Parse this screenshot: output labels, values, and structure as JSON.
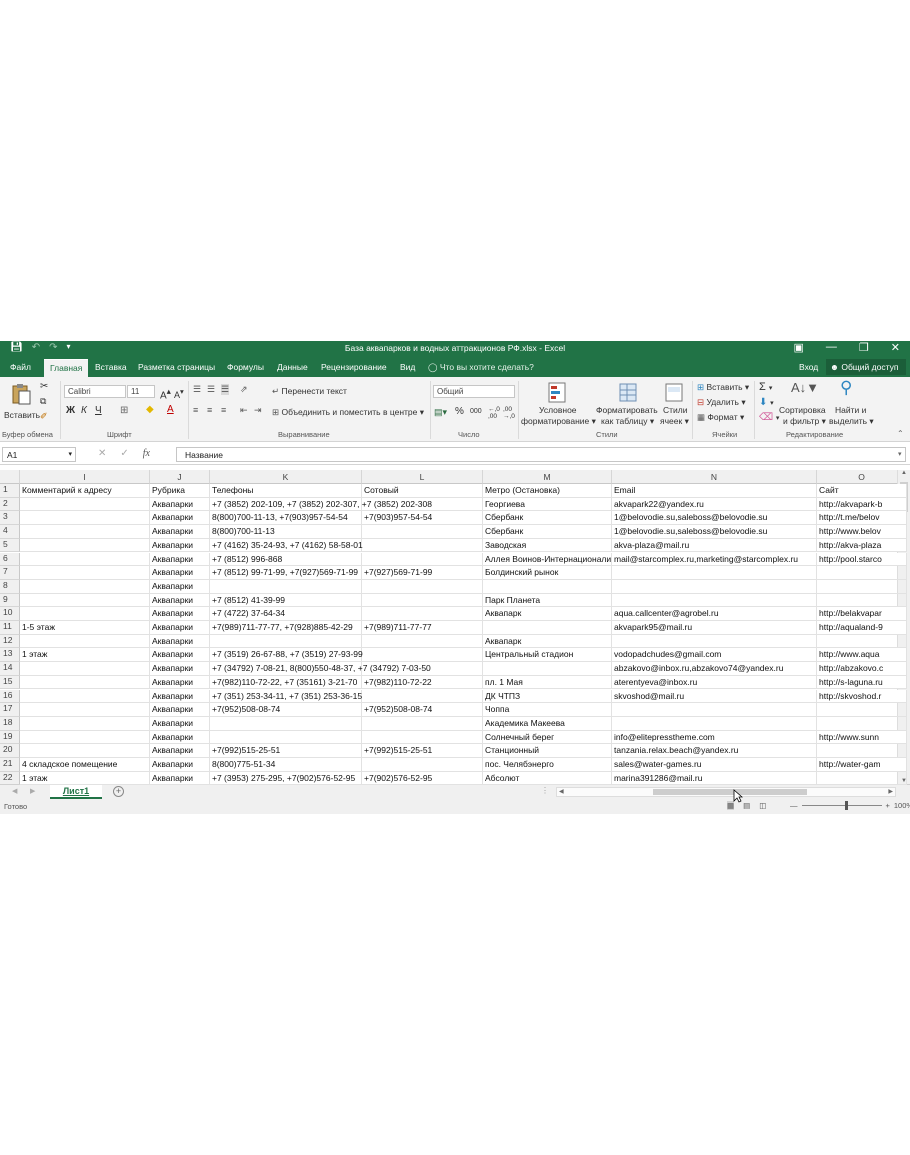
{
  "window": {
    "title": "База аквапарков и водных аттракционов РФ.xlsx - Excel"
  },
  "ribbon_tabs": [
    "Файл",
    "Главная",
    "Вставка",
    "Разметка страницы",
    "Формулы",
    "Данные",
    "Рецензирование",
    "Вид"
  ],
  "tell_me": "Что вы хотите сделать?",
  "signin": "Вход",
  "share": "Общий доступ",
  "ribbon": {
    "paste": "Вставить",
    "font_name": "Calibri",
    "font_size": "11",
    "wrap_text": "Перенести текст",
    "merge_center": "Объединить и поместить в центре",
    "number_format": "Общий",
    "cond_format_1": "Условное",
    "cond_format_2": "форматирование",
    "format_table_1": "Форматировать",
    "format_table_2": "как таблицу",
    "styles_1": "Стили",
    "styles_2": "ячеек",
    "insert": "Вставить",
    "delete": "Удалить",
    "format": "Формат",
    "sort_1": "Сортировка",
    "sort_2": "и фильтр",
    "find_1": "Найти и",
    "find_2": "выделить",
    "bold": "Ж",
    "italic": "К",
    "underline": "Ч",
    "groups": {
      "clipboard": "Буфер обмена",
      "font": "Шрифт",
      "alignment": "Выравнивание",
      "number": "Число",
      "styles": "Стили",
      "cells": "Ячейки",
      "editing": "Редактирование"
    }
  },
  "formula_bar": {
    "name_box": "A1",
    "fx": "fx",
    "content": "Название"
  },
  "sheet": {
    "columns": [
      "I",
      "J",
      "K",
      "L",
      "M",
      "N",
      "O"
    ],
    "row_numbers": [
      "1",
      "2",
      "3",
      "4",
      "5",
      "6",
      "7",
      "8",
      "9",
      "10",
      "11",
      "12",
      "13",
      "14",
      "15",
      "16",
      "17",
      "18",
      "19",
      "20",
      "21",
      "22"
    ],
    "rows": [
      [
        "Комментарий к адресу",
        "Рубрика",
        "Телефоны",
        "Сотовый",
        "Метро (Остановка)",
        "Email",
        "Сайт"
      ],
      [
        "",
        "Аквапарки",
        "+7 (3852) 202-109, +7 (3852) 202-307, +7 (3852) 202-308",
        "",
        "Георгиева",
        "akvapark22@yandex.ru",
        "http://akvapark-b"
      ],
      [
        "",
        "Аквапарки",
        "8(800)700-11-13, +7(903)957-54-54",
        "+7(903)957-54-54",
        "Сбербанк",
        "1@belovodie.su,saleboss@belovodie.su",
        "http://t.me/belov"
      ],
      [
        "",
        "Аквапарки",
        "8(800)700-11-13",
        "",
        "Сбербанк",
        "1@belovodie.su,saleboss@belovodie.su",
        "http://www.belov"
      ],
      [
        "",
        "Аквапарки",
        "+7 (4162) 35-24-93, +7 (4162) 58-58-01",
        "",
        "Заводская",
        "akva-plaza@mail.ru",
        "http://akva-plaza"
      ],
      [
        "",
        "Аквапарки",
        "+7 (8512) 996-868",
        "",
        "Аллея Воинов-Интернационалистов",
        "mail@starcomplex.ru,marketing@starcomplex.ru",
        "http://pool.starco"
      ],
      [
        "",
        "Аквапарки",
        "+7 (8512) 99-71-99, +7(927)569-71-99",
        "+7(927)569-71-99",
        "Болдинский рынок",
        "",
        ""
      ],
      [
        "",
        "Аквапарки",
        "",
        "",
        "",
        "",
        ""
      ],
      [
        "",
        "Аквапарки",
        "+7 (8512) 41-39-99",
        "",
        "Парк Планета",
        "",
        ""
      ],
      [
        "",
        "Аквапарки",
        "+7 (4722) 37-64-34",
        "",
        "Аквапарк",
        "aqua.callcenter@agrobel.ru",
        "http://belakvapar"
      ],
      [
        "1-5 этаж",
        "Аквапарки",
        "+7(989)711-77-77, +7(928)885-42-29",
        "+7(989)711-77-77",
        "",
        "akvapark95@mail.ru",
        "http://aqualand-9"
      ],
      [
        "",
        "Аквапарки",
        "",
        "",
        "Аквапарк",
        "",
        ""
      ],
      [
        "1 этаж",
        "Аквапарки",
        "+7 (3519) 26-67-88, +7 (3519) 27-93-99",
        "",
        "Центральный стадион",
        "vodopadchudes@gmail.com",
        "http://www.aqua"
      ],
      [
        "",
        "Аквапарки",
        "+7 (34792) 7-08-21, 8(800)550-48-37, +7 (34792) 7-03-50",
        "",
        "",
        "abzakovo@inbox.ru,abzakovo74@yandex.ru",
        "http://abzakovo.c"
      ],
      [
        "",
        "Аквапарки",
        "+7(982)110-72-22, +7 (35161) 3-21-70",
        "+7(982)110-72-22",
        "пл. 1 Мая",
        "aterentyeva@inbox.ru",
        "http://s-laguna.ru"
      ],
      [
        "",
        "Аквапарки",
        "+7 (351) 253-34-11, +7 (351) 253-36-15",
        "",
        "ДК ЧТПЗ",
        "skvoshod@mail.ru",
        "http://skvoshod.r"
      ],
      [
        "",
        "Аквапарки",
        "+7(952)508-08-74",
        "+7(952)508-08-74",
        "Чоппа",
        "",
        ""
      ],
      [
        "",
        "Аквапарки",
        "",
        "",
        "Академика Макеева",
        "",
        ""
      ],
      [
        "",
        "Аквапарки",
        "",
        "",
        "Солнечный берег",
        "info@elitepresstheme.com",
        "http://www.sunn"
      ],
      [
        "",
        "Аквапарки",
        "+7(992)515-25-51",
        "+7(992)515-25-51",
        "Станционный",
        "tanzania.relax.beach@yandex.ru",
        ""
      ],
      [
        "4 складское помещение",
        "Аквапарки",
        "8(800)775-51-34",
        "",
        "пос. Челябэнерго",
        "sales@water-games.ru",
        "http://water-gam"
      ],
      [
        "1 этаж",
        "Аквапарки",
        "+7 (3953) 275-295, +7(902)576-52-95",
        "+7(902)576-52-95",
        "Абсолют",
        "marina391286@mail.ru",
        ""
      ]
    ]
  },
  "sheet_tab": "Лист1",
  "status": {
    "ready": "Готово",
    "zoom": "100%"
  },
  "colors": {
    "accent": "#217346"
  }
}
